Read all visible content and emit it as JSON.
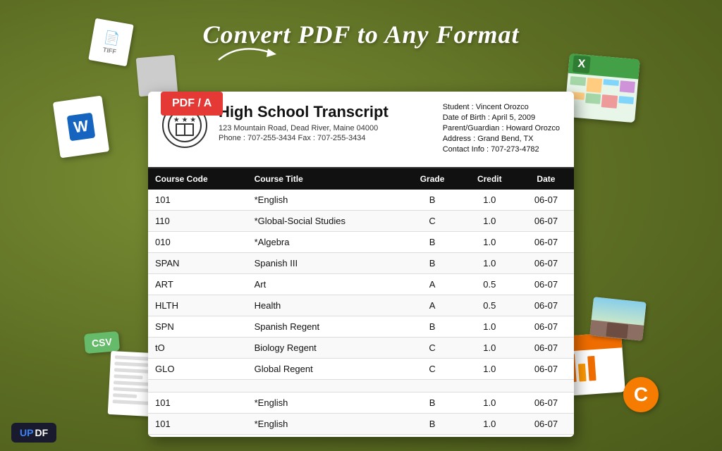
{
  "page": {
    "title": "Convert PDF to Any Format",
    "background_color": "#6b7c2e"
  },
  "badges": {
    "pdf_a": "PDF / A",
    "csv": "CSV",
    "c_badge": "C"
  },
  "school": {
    "name": "High School Transcript",
    "address": "123 Mountain Road, Dead River, Maine 04000",
    "phone_fax": "Phone : 707-255-3434    Fax : 707-255-3434"
  },
  "student": {
    "name_label": "Student : Vincent Orozco",
    "dob_label": "Date of Birth : April 5, 2009",
    "parent_label": "Parent/Guardian : Howard Orozco",
    "address_label": "Address : Grand Bend, TX",
    "contact_label": "Contact Info : 707-273-4782"
  },
  "table": {
    "headers": [
      "Course Code",
      "Course Title",
      "Grade",
      "Credit",
      "Date"
    ],
    "rows": [
      {
        "code": "101",
        "title": "*English",
        "grade": "B",
        "credit": "1.0",
        "date": "06-07"
      },
      {
        "code": "110",
        "title": "*Global-Social Studies",
        "grade": "C",
        "credit": "1.0",
        "date": "06-07"
      },
      {
        "code": "010",
        "title": "*Algebra",
        "grade": "B",
        "credit": "1.0",
        "date": "06-07"
      },
      {
        "code": "SPAN",
        "title": "Spanish III",
        "grade": "B",
        "credit": "1.0",
        "date": "06-07"
      },
      {
        "code": "ART",
        "title": "Art",
        "grade": "A",
        "credit": "0.5",
        "date": "06-07"
      },
      {
        "code": "HLTH",
        "title": "Health",
        "grade": "A",
        "credit": "0.5",
        "date": "06-07"
      },
      {
        "code": "SPN",
        "title": "Spanish Regent",
        "grade": "B",
        "credit": "1.0",
        "date": "06-07"
      },
      {
        "code": "tO",
        "title": "Biology Regent",
        "grade": "C",
        "credit": "1.0",
        "date": "06-07"
      },
      {
        "code": "GLO",
        "title": "Global Regent",
        "grade": "C",
        "credit": "1.0",
        "date": "06-07"
      },
      {
        "code": "",
        "title": "",
        "grade": "",
        "credit": "",
        "date": ""
      },
      {
        "code": "101",
        "title": "*English",
        "grade": "B",
        "credit": "1.0",
        "date": "06-07"
      },
      {
        "code": "101",
        "title": "*English",
        "grade": "B",
        "credit": "1.0",
        "date": "06-07"
      }
    ]
  },
  "updf": {
    "label_up": "UP",
    "label_df": "DF"
  }
}
